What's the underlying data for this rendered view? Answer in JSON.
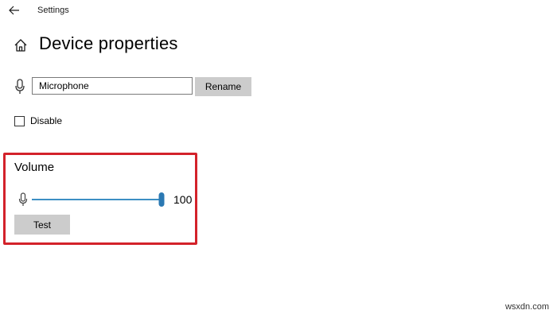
{
  "header": {
    "back_icon": "back-arrow-icon",
    "app_title": "Settings"
  },
  "page": {
    "home_icon": "home-icon",
    "title": "Device properties"
  },
  "device": {
    "icon": "microphone-icon",
    "name_value": "Microphone",
    "rename_label": "Rename"
  },
  "disable": {
    "label": "Disable",
    "checked": false
  },
  "volume": {
    "title": "Volume",
    "icon": "microphone-icon",
    "level": 100,
    "value_label": "100",
    "test_label": "Test"
  },
  "watermark": "wsxdn.com",
  "colors": {
    "highlight_border": "#d3222a",
    "slider_accent": "#2b79b3",
    "button_bg": "#cccccc"
  }
}
